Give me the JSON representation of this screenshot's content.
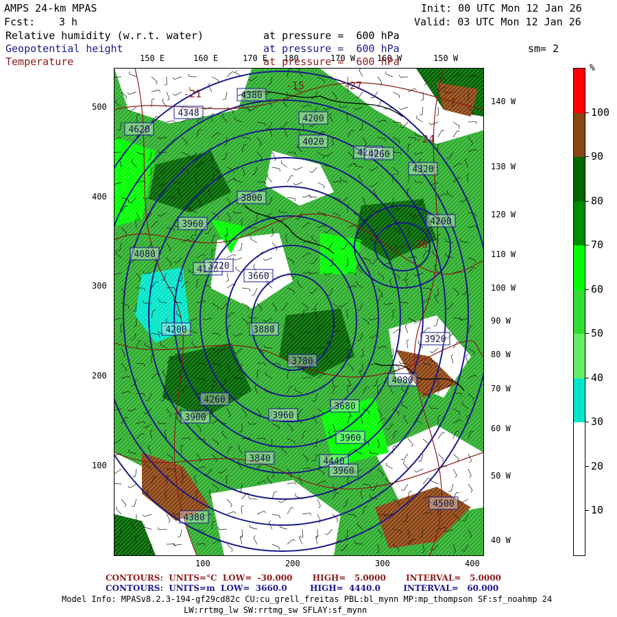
{
  "header": {
    "model": "AMPS 24-km MPAS",
    "fcst_label": "Fcst:",
    "fcst_value": "3 h",
    "init": "Init: 00 UTC Mon 12 Jan 26",
    "valid": "Valid: 03 UTC Mon 12 Jan 26",
    "fields": [
      {
        "name": "Relative humidity (w.r.t. water)",
        "level": "at pressure =  600 hPa",
        "color": "#000000"
      },
      {
        "name": "Geopotential height",
        "level": "at pressure =  600 hPa",
        "color": "#1a1a8c"
      },
      {
        "name": "Temperature",
        "level": "at pressure =  600 hPa",
        "color": "#8c1a1a"
      }
    ],
    "smoothing": "sm= 2"
  },
  "map": {
    "top_lon_labels": [
      "150 E",
      "160 E",
      "170 E",
      "180",
      "170 W",
      "160 W",
      "150 W"
    ],
    "right_lon_labels": [
      "140 W",
      "130 W",
      "120 W",
      "110 W",
      "100 W",
      "90 W",
      "80 W",
      "70 W",
      "60 W",
      "50 W",
      "40 W"
    ],
    "y_ticks": [
      "500",
      "400",
      "300",
      "200",
      "100"
    ],
    "x_ticks": [
      "100",
      "200",
      "300",
      "400"
    ],
    "height_labels": [
      "4380",
      "4348",
      "4260",
      "4020",
      "4200",
      "4620",
      "4260",
      "4320",
      "4080",
      "4200",
      "3960",
      "4140",
      "3800",
      "3880",
      "4200",
      "3780",
      "3840",
      "3900",
      "3660",
      "3720",
      "3960",
      "4080",
      "4380",
      "4440",
      "4500",
      "4260",
      "3960",
      "3960",
      "3680",
      "3920"
    ],
    "temp_labels": [
      "-21",
      "-15",
      "-27",
      "-24",
      "-30"
    ],
    "line_colors": {
      "height": "#1a1a8c",
      "temp": "#8c1a1a",
      "wind": "#1a1a1a"
    }
  },
  "colorbar": {
    "unit": "%",
    "labels": [
      "100",
      "90",
      "80",
      "70",
      "60",
      "50",
      "40",
      "30",
      "20",
      "10"
    ],
    "colors": [
      "#ff0000",
      "#8b4513",
      "#006400",
      "#008c00",
      "#00ff00",
      "#33dd33",
      "#66ee66",
      "#00e6c8",
      "#ffffff",
      "#ffffff"
    ]
  },
  "footer": {
    "temp_contours": "CONTOURS:  UNITS=°C  LOW=  -30.000       HIGH=   5.0000       INTERVAL=   5.0000",
    "height_contours": "CONTOURS:  UNITS=m  LOW=  3660.0        HIGH=  4440.0        INTERVAL=   60.000",
    "model_info": "Model Info: MPASv8.2.3-194-gf29cd82c CU:cu_grell_freitas PBL:bl_mynn MP:mp_thompson SF:sf_noahmp 24",
    "model_info2": "LW:rrtmg_lw SW:rrtmg_sw SFLAY:sf_mynn"
  }
}
